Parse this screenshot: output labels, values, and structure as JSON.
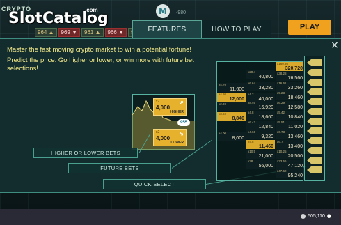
{
  "logo": {
    "crypto": "CRYPTO",
    "slot": "SlotCatalog",
    "com": ".com"
  },
  "badge_letter": "M",
  "bg_top_value": "-980",
  "bg_chips": [
    "964 ▲",
    "969 ▼",
    "961 ▲",
    "966 ▼",
    "964 ▲"
  ],
  "play_label": "PLAY",
  "tabs": [
    {
      "label": "FEATURES"
    },
    {
      "label": "HOW TO PLAY"
    }
  ],
  "close_icon": "×",
  "intro": [
    "Master the fast moving crypto market to win a potential fortune!",
    "Predict the price: Go higher or lower, or win more with future bet selections!"
  ],
  "illustration": {
    "higher_card": {
      "mult": "x2",
      "amount": "4,000",
      "dir": "HIGHER",
      "arrow": "↗"
    },
    "lower_card": {
      "mult": "x2",
      "amount": "4,000",
      "dir": "LOWER",
      "arrow": "↘"
    },
    "price": "955"
  },
  "feature_buttons": {
    "higher_lower": "HIGHER OR LOWER BETS",
    "future": "FUTURE BETS",
    "quick": "QUICK SELECT"
  },
  "grid": {
    "col1": [
      {
        "m": "x4.70",
        "v": "11,600",
        "style": "dark"
      },
      {
        "m": "x4.80",
        "v": "12,000",
        "style": "gold"
      },
      {
        "m": "x2.90",
        "v": "",
        "style": "dark"
      },
      {
        "m": "x3.60",
        "v": "8,840",
        "style": "gold"
      },
      {
        "m": "x4.00",
        "v": "8,000",
        "style": "dark"
      }
    ],
    "col2": [
      {
        "m": "x20.4",
        "v": "40,800",
        "style": "dark"
      },
      {
        "m": "x6.64",
        "v": "33,280",
        "style": "dark"
      },
      {
        "m": "x4.2",
        "v": "40,000",
        "style": "dark"
      },
      {
        "m": "x8.46",
        "v": "16,920",
        "style": "dark"
      },
      {
        "m": "x4.8",
        "v": "18,660",
        "style": "dark"
      },
      {
        "m": "x6.42",
        "v": "12,840",
        "style": "dark"
      },
      {
        "m": "x4.66",
        "v": "9,320",
        "style": "dark"
      },
      {
        "m": "x4.8",
        "v": "11,460",
        "style": "gold"
      },
      {
        "m": "x10.5",
        "v": "21,000",
        "style": "dark"
      },
      {
        "m": "x28",
        "v": "56,000",
        "style": "dark"
      }
    ],
    "col3": [
      {
        "m": "x160.36",
        "v": "320,720",
        "style": "gold"
      },
      {
        "m": "x38.28",
        "v": "76,560",
        "style": "dark"
      },
      {
        "m": "x16.61",
        "v": "33,260",
        "style": "dark"
      },
      {
        "m": "x9.23",
        "v": "18,460",
        "style": "dark"
      },
      {
        "m": "x6.29",
        "v": "12,580",
        "style": "dark"
      },
      {
        "m": "x5.42",
        "v": "10,840",
        "style": "dark"
      },
      {
        "m": "x5.51",
        "v": "11,020",
        "style": "dark"
      },
      {
        "m": "x6.73",
        "v": "13,460",
        "style": "dark"
      },
      {
        "m": "x6.7",
        "v": "13,400",
        "style": "dark"
      },
      {
        "m": "x10.25",
        "v": "20,500",
        "style": "dark"
      },
      {
        "m": "x23.56",
        "v": "47,120",
        "style": "dark"
      },
      {
        "m": "x47.62",
        "v": "95,240",
        "style": "dark"
      }
    ]
  },
  "balance": "505,110"
}
